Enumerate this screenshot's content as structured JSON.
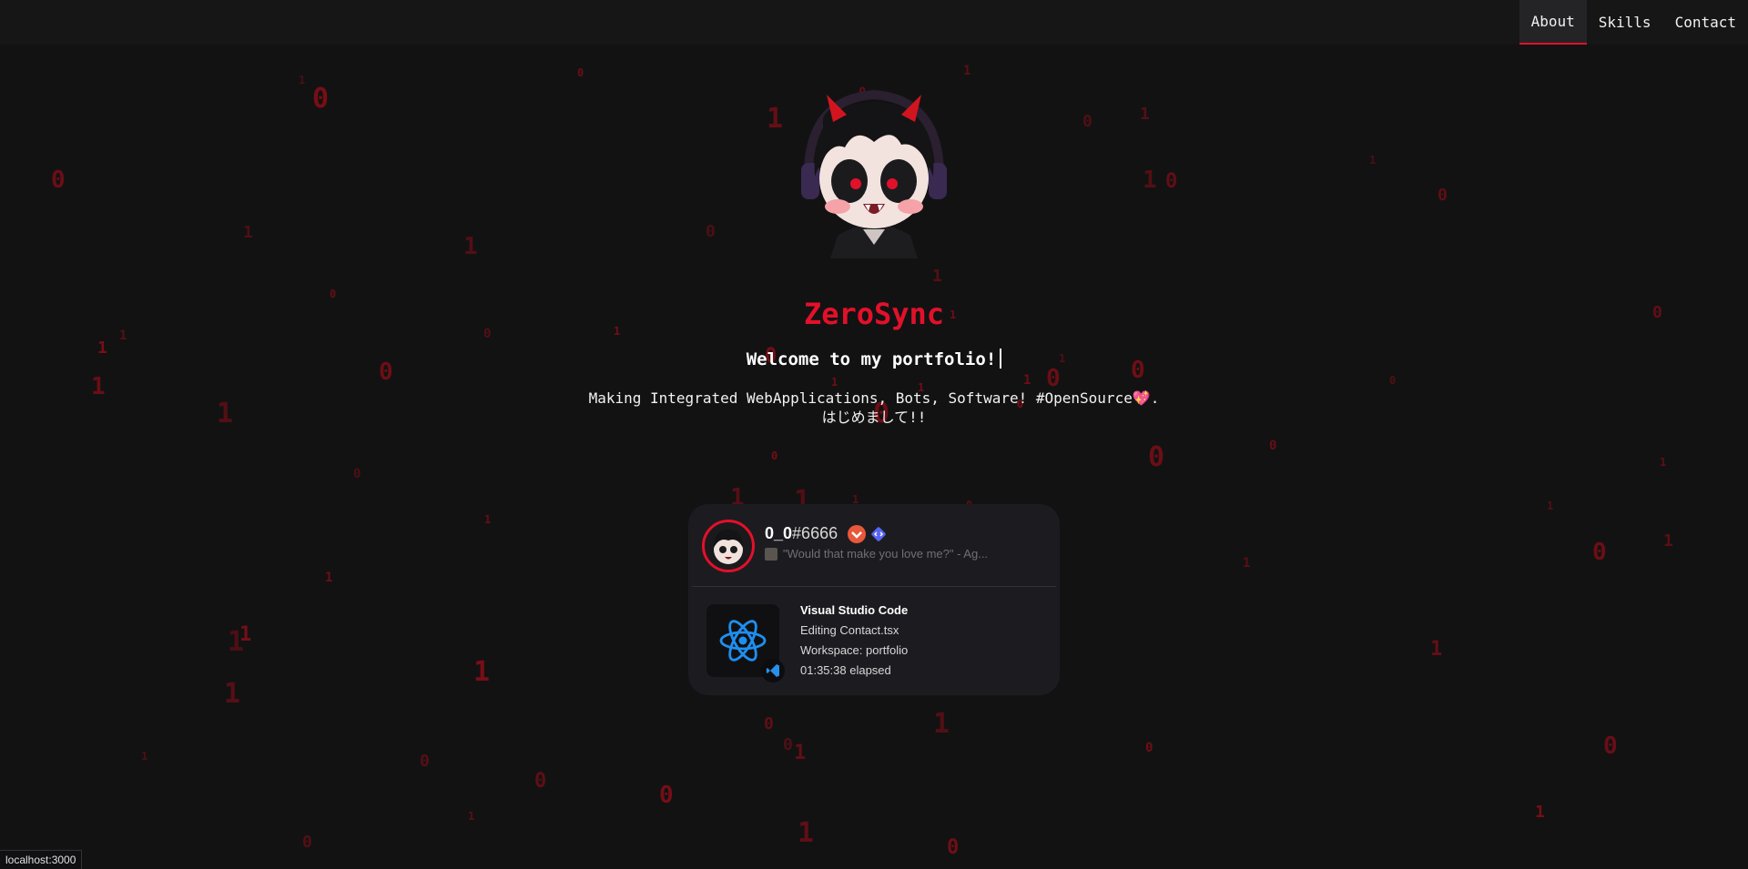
{
  "nav": {
    "items": [
      "About",
      "Skills",
      "Contact"
    ],
    "active": "About"
  },
  "hero": {
    "name": "ZeroSync",
    "welcome": "Welcome to my portfolio!",
    "subtitle_line1": "Making Integrated WebApplications, Bots, Software! #OpenSource💖.",
    "subtitle_line2": "はじめまして!!"
  },
  "discord": {
    "username": "0_0",
    "discriminator": "#6666",
    "status": "\"Would that make you love me?\" - Ag...",
    "activity": {
      "app": "Visual Studio Code",
      "details": "Editing Contact.tsx",
      "state": "Workspace: portfolio",
      "elapsed": "01:35:38 elapsed"
    }
  },
  "statusbar": {
    "url": "localhost:3000"
  },
  "colors": {
    "accent": "#e3102a",
    "background": "#121213",
    "rain": "#7a0e16",
    "card": "#1c1c20"
  },
  "rain_digits": [
    "1",
    "0",
    "1",
    "1",
    "0",
    "0",
    "1",
    "1",
    "0",
    "1",
    "1",
    "0",
    "0",
    "1",
    "1",
    "0",
    "0",
    "1",
    "1",
    "0",
    "1",
    "0",
    "1",
    "0",
    "1",
    "1",
    "0",
    "0",
    "1",
    "1",
    "0",
    "1",
    "1",
    "0",
    "1",
    "0",
    "1",
    "1",
    "0",
    "0",
    "1",
    "0",
    "1",
    "1",
    "0",
    "1",
    "0",
    "0",
    "1",
    "1",
    "0",
    "1",
    "1",
    "0",
    "0",
    "1",
    "1",
    "0",
    "1",
    "0",
    "1",
    "1",
    "0",
    "1",
    "0",
    "1",
    "0",
    "0",
    "1",
    "1",
    "0",
    "1",
    "1",
    "0",
    "0"
  ]
}
